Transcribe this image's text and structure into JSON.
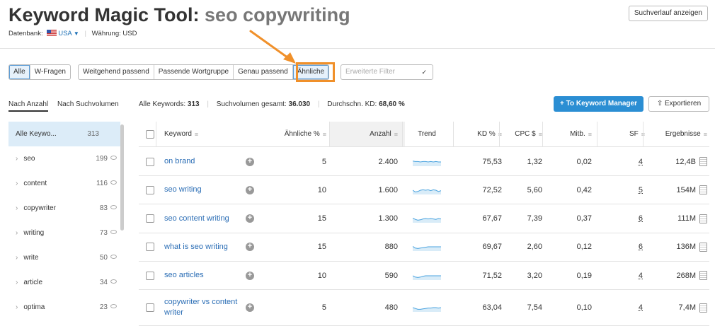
{
  "header": {
    "title": "Keyword Magic Tool:",
    "query": "seo copywriting",
    "history_button": "Suchverlauf anzeigen",
    "database_label": "Datenbank:",
    "database_value": "USA",
    "currency_label": "Währung:",
    "currency_value": "USD"
  },
  "filters": {
    "group1": [
      "Alle",
      "W-Fragen"
    ],
    "group2": [
      "Weitgehend passend",
      "Passende Wortgruppe",
      "Genau passend",
      "Ähnliche"
    ],
    "active_group1": "Alle",
    "active_group2": "Ähnliche",
    "advanced_placeholder": "Erweiterte Filter",
    "highlight_color": "#f0902a"
  },
  "sidebar": {
    "tabs": [
      "Nach Anzahl",
      "Nach Suchvolumen"
    ],
    "active_tab": "Nach Anzahl",
    "items": [
      {
        "label": "Alle Keywo...",
        "count": "313"
      },
      {
        "label": "seo",
        "count": "199"
      },
      {
        "label": "content",
        "count": "116"
      },
      {
        "label": "copywriter",
        "count": "83"
      },
      {
        "label": "writing",
        "count": "73"
      },
      {
        "label": "write",
        "count": "50"
      },
      {
        "label": "article",
        "count": "34"
      },
      {
        "label": "optima",
        "count": "23"
      }
    ]
  },
  "summary": {
    "all_keywords_label": "Alle Keywords:",
    "all_keywords_value": "313",
    "volume_label": "Suchvolumen gesamt:",
    "volume_value": "36.030",
    "kd_label": "Durchschn. KD:",
    "kd_value": "68,60 %"
  },
  "actions": {
    "to_manager": "To Keyword Manager",
    "export": "Exportieren",
    "primary_color": "#2b8ed3"
  },
  "table": {
    "headers": {
      "keyword": "Keyword",
      "similar": "Ähnliche %",
      "volume": "Anzahl",
      "trend": "Trend",
      "kd": "KD %",
      "cpc": "CPC $",
      "comp": "Mitb.",
      "sf": "SF",
      "results": "Ergebnisse"
    },
    "rows": [
      {
        "keyword": "on brand",
        "similar": "5",
        "volume": "2.400",
        "kd": "75,53",
        "cpc": "1,32",
        "comp": "0,02",
        "sf": "4",
        "results": "12,4B",
        "trend": [
          0.6,
          0.55,
          0.55,
          0.5,
          0.55,
          0.55,
          0.5,
          0.55,
          0.5,
          0.55,
          0.5,
          0.5
        ]
      },
      {
        "keyword": "seo writing",
        "similar": "10",
        "volume": "1.600",
        "kd": "72,52",
        "cpc": "5,60",
        "comp": "0,42",
        "sf": "5",
        "results": "154M",
        "trend": [
          0.5,
          0.3,
          0.35,
          0.5,
          0.55,
          0.5,
          0.55,
          0.45,
          0.55,
          0.5,
          0.35,
          0.45
        ]
      },
      {
        "keyword": "seo content writing",
        "similar": "15",
        "volume": "1.300",
        "kd": "67,67",
        "cpc": "7,39",
        "comp": "0,37",
        "sf": "6",
        "results": "111M",
        "trend": [
          0.55,
          0.4,
          0.3,
          0.35,
          0.45,
          0.5,
          0.45,
          0.5,
          0.45,
          0.4,
          0.5,
          0.45
        ]
      },
      {
        "keyword": "what is seo writing",
        "similar": "15",
        "volume": "880",
        "kd": "69,67",
        "cpc": "2,60",
        "comp": "0,12",
        "sf": "6",
        "results": "136M",
        "trend": [
          0.55,
          0.35,
          0.3,
          0.35,
          0.4,
          0.45,
          0.5,
          0.5,
          0.5,
          0.5,
          0.5,
          0.5
        ]
      },
      {
        "keyword": "seo articles",
        "similar": "10",
        "volume": "590",
        "kd": "71,52",
        "cpc": "3,20",
        "comp": "0,19",
        "sf": "4",
        "results": "268M",
        "trend": [
          0.5,
          0.35,
          0.3,
          0.35,
          0.45,
          0.5,
          0.5,
          0.5,
          0.5,
          0.5,
          0.5,
          0.5
        ]
      },
      {
        "keyword": "copywriter vs content writer",
        "similar": "5",
        "volume": "480",
        "kd": "63,04",
        "cpc": "7,54",
        "comp": "0,10",
        "sf": "4",
        "results": "7,4M",
        "trend": [
          0.5,
          0.4,
          0.3,
          0.3,
          0.35,
          0.4,
          0.45,
          0.45,
          0.5,
          0.5,
          0.45,
          0.5
        ]
      }
    ]
  }
}
